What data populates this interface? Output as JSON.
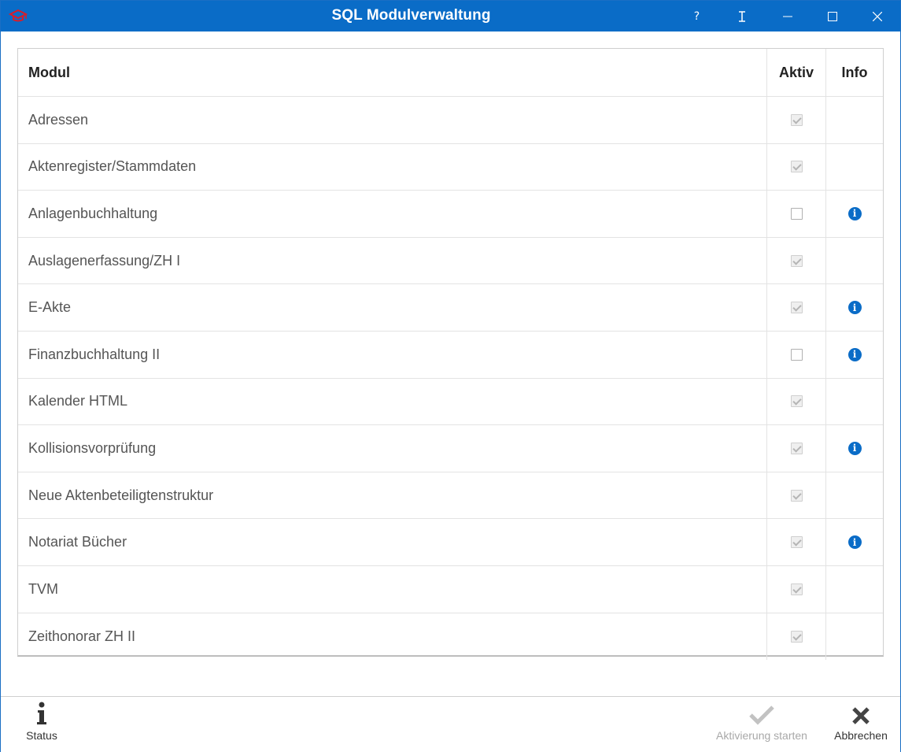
{
  "window": {
    "title": "SQL Modulverwaltung",
    "help_label": "?",
    "accent_color": "#0a6cc7"
  },
  "table": {
    "columns": [
      "Modul",
      "Aktiv",
      "Info"
    ],
    "rows": [
      {
        "modul": "Adressen",
        "aktiv": true,
        "aktiv_enabled": false,
        "info": false
      },
      {
        "modul": "Aktenregister/Stammdaten",
        "aktiv": true,
        "aktiv_enabled": false,
        "info": false
      },
      {
        "modul": "Anlagenbuchhaltung",
        "aktiv": false,
        "aktiv_enabled": true,
        "info": true
      },
      {
        "modul": "Auslagenerfassung/ZH I",
        "aktiv": true,
        "aktiv_enabled": false,
        "info": false
      },
      {
        "modul": "E-Akte",
        "aktiv": true,
        "aktiv_enabled": false,
        "info": true
      },
      {
        "modul": "Finanzbuchhaltung II",
        "aktiv": false,
        "aktiv_enabled": true,
        "info": true
      },
      {
        "modul": "Kalender HTML",
        "aktiv": true,
        "aktiv_enabled": false,
        "info": false
      },
      {
        "modul": "Kollisionsvorprüfung",
        "aktiv": true,
        "aktiv_enabled": false,
        "info": true
      },
      {
        "modul": "Neue Aktenbeteiligtenstruktur",
        "aktiv": true,
        "aktiv_enabled": false,
        "info": false
      },
      {
        "modul": "Notariat Bücher",
        "aktiv": true,
        "aktiv_enabled": false,
        "info": true
      },
      {
        "modul": "TVM",
        "aktiv": true,
        "aktiv_enabled": false,
        "info": false
      },
      {
        "modul": "Zeithonorar ZH II",
        "aktiv": true,
        "aktiv_enabled": false,
        "info": false
      }
    ]
  },
  "footer": {
    "status_label": "Status",
    "activate_label": "Aktivierung starten",
    "activate_enabled": false,
    "cancel_label": "Abbrechen"
  }
}
